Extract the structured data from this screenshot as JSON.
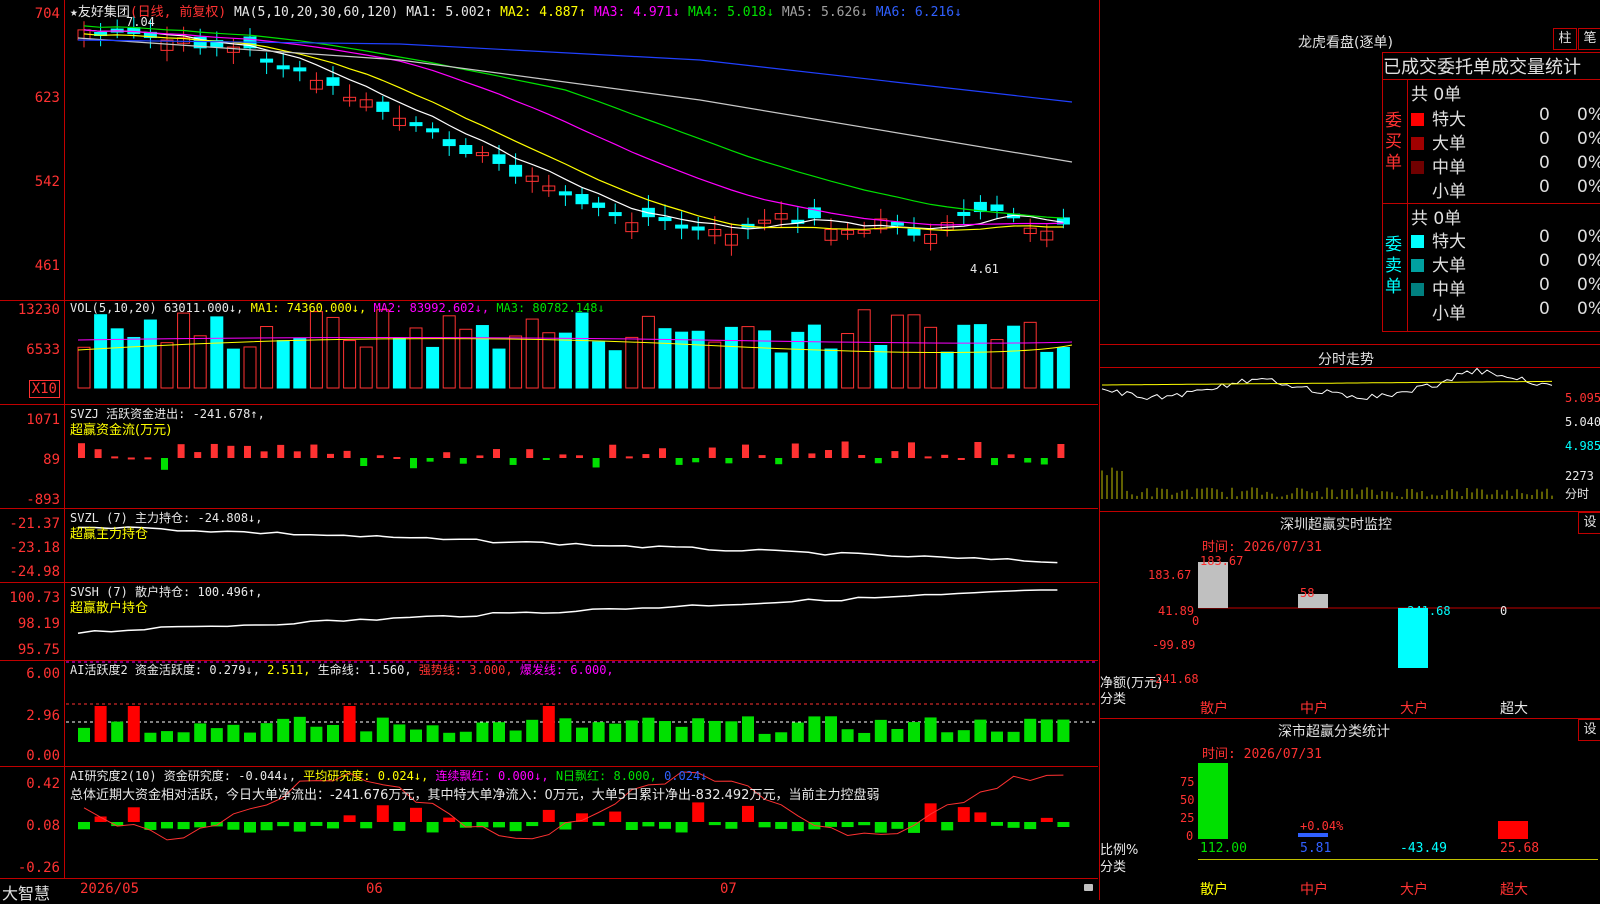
{
  "kline": {
    "star": "★",
    "name": "友好集团",
    "type_label": "(日线, 前复权)",
    "ma_label": "MA(5,10,20,30,60,120)",
    "ma1": "MA1: 5.002↑",
    "ma2": "MA2: 4.887↑",
    "ma3": "MA3: 4.971↓",
    "ma4": "MA4: 5.018↓",
    "ma5": "MA5: 5.626↓",
    "ma6": "MA6: 6.216↓",
    "y_ticks": [
      "704",
      "623",
      "542",
      "461"
    ],
    "high_mark": "7.04",
    "low_mark": "4.61",
    "colors": {
      "up": "#ff3232",
      "down": "#00ffff",
      "ma1": "#ffffff",
      "ma2": "#ffff00",
      "ma3": "#ff00ff",
      "ma4": "#00e000",
      "ma5": "#c8c8c8",
      "ma6": "#2040ff"
    }
  },
  "vol": {
    "title": "VOL(5,10,20)",
    "value": "63011.000↓,",
    "ma1": "MA1: 74360.000↓,",
    "ma2": "MA2: 83992.602↓,",
    "ma3": "MA3: 80782.148↓",
    "y_ticks": [
      "13230",
      "6533"
    ],
    "unit": "X10"
  },
  "svzj": {
    "title": "SVZJ  活跃资金进出: -241.678↑,",
    "sub": "超赢资金流(万元)",
    "y_ticks": [
      "1071",
      "89",
      "-893"
    ]
  },
  "svzl": {
    "title": "SVZL (7) 主力持仓: -24.808↓,",
    "sub": "超赢主力持仓",
    "y_ticks": [
      "-21.37",
      "-23.18",
      "-24.98"
    ]
  },
  "svsh": {
    "title": "SVSH (7) 散户持仓: 100.496↑,",
    "sub": "超赢散户持仓",
    "y_ticks": [
      "100.73",
      "98.19",
      "95.75"
    ]
  },
  "ai_active": {
    "title": "AI活跃度2 资金活跃度: 0.279↓,",
    "v2": "2.511,",
    "life": "生命线: 1.560,",
    "strong": "强势线: 3.000,",
    "burst": "爆发线: 6.000,",
    "y_ticks": [
      "6.00",
      "2.96",
      "0.00"
    ]
  },
  "ai_research": {
    "title": "AI研究度2(10) 资金研究度: -0.044↓,",
    "avg": "平均研究度: 0.024↓,",
    "cont": "连续飘红: 0.000↓,",
    "nday": "N日飘红: 8.000,",
    "last": "0.024↓",
    "summary": "总体近期大资金相对活跃，今日大单净流出：-241.676万元，其中特大单净流入：0万元，大单5日累计净出-832.492万元，当前主力控盘弱",
    "y_ticks": [
      "0.42",
      "0.08",
      "-0.26"
    ]
  },
  "bottom": {
    "brand": "大智慧",
    "date1": "2026/05",
    "date2": "06",
    "date3": "07"
  },
  "lhb": {
    "title": "龙虎看盘(逐单)",
    "btn1": "柱",
    "btn2": "笔",
    "header": "已成交委托单成交量统计",
    "buy_total": "共 0单",
    "buy_label": "委买单",
    "sell_total": "共 0单",
    "sell_label": "委卖单",
    "buy_rows": [
      {
        "name": "特大",
        "count": "0",
        "pct": "0%",
        "color": "#ff0000"
      },
      {
        "name": "大单",
        "count": "0",
        "pct": "0%",
        "color": "#a00000"
      },
      {
        "name": "中单",
        "count": "0",
        "pct": "0%",
        "color": "#700000"
      },
      {
        "name": "小单",
        "count": "0",
        "pct": "0%",
        "color": "#000000"
      }
    ],
    "sell_rows": [
      {
        "name": "特大",
        "count": "0",
        "pct": "0%",
        "color": "#00ffff"
      },
      {
        "name": "大单",
        "count": "0",
        "pct": "0%",
        "color": "#00a0a0"
      },
      {
        "name": "中单",
        "count": "0",
        "pct": "0%",
        "color": "#008080"
      },
      {
        "name": "小单",
        "count": "0",
        "pct": "0%",
        "color": "#000000"
      }
    ]
  },
  "intraday": {
    "title": "分时走势",
    "y_ticks": [
      "5.095",
      "5.040",
      "4.985"
    ],
    "vol_tick": "2273",
    "vol_unit": "分时"
  },
  "monitor": {
    "title": "深圳超赢实时监控",
    "settings": "设",
    "time": "时间: 2026/07/31",
    "y_ticks": [
      "183.67",
      "41.89",
      "0",
      "-99.89",
      "-241.68"
    ],
    "ylabel": "净额(万元)",
    "xlabel": "分类",
    "categories": [
      "散户",
      "中户",
      "大户",
      "超大"
    ],
    "values": [
      "183.67",
      "58",
      "-241.68",
      "0"
    ]
  },
  "classify": {
    "title": "深市超赢分类统计",
    "settings": "设",
    "time": "时间: 2026/07/31",
    "y_ticks": [
      "75",
      "50",
      "25",
      "0"
    ],
    "ylabel": "比例%",
    "xlabel": "分类",
    "categories": [
      "散户",
      "中户",
      "大户",
      "超大"
    ],
    "values": [
      "112.00",
      "5.81",
      "-43.49",
      "25.68"
    ],
    "mid_label": "+0.04%"
  }
}
